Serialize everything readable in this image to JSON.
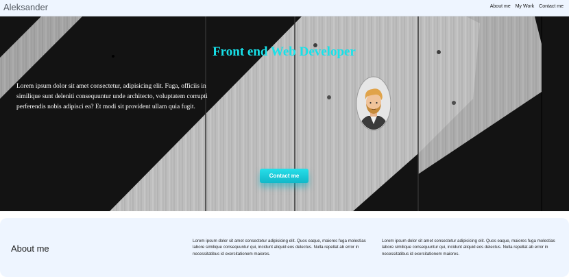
{
  "navbar": {
    "brand": "Aleksander",
    "links": [
      "About me",
      "My Work",
      "Contact me"
    ]
  },
  "hero": {
    "title": "Front end Web Developer",
    "text": "Lorem ipsum dolor sit amet consectetur, adipisicing elit. Fuga, officiis in similique sunt deleniti consequuntur unde architecto, voluptatem corrupti perferendis nobis adipisci ea? Et modi sit provident ullam quia fugit.",
    "button_label": "Contact me"
  },
  "about": {
    "title": "About me",
    "paragraphs": [
      "Lorem ipsum dolor sit amet consectetur adipisicing elit. Quos eaque, maiores fuga molestias labore similique consequuntur qui, incidunt aliquid eos delectus. Nulla repellat ab error in necessitatibus id exercitationem maiores.",
      "Lorem ipsum dolor sit amet consectetur adipisicing elit. Quos eaque, maiores fuga molestias labore similique consequuntur qui, incidunt aliquid eos delectus. Nulla repellat ab error in necessitatibus id exercitationem maiores."
    ]
  },
  "colors": {
    "accent": "#17e2ea",
    "navbar_bg": "#eef5ff",
    "hero_dark": "#151515",
    "hero_stripe": "#c9c9c9"
  },
  "icons": [
    "avatar-illustration"
  ]
}
